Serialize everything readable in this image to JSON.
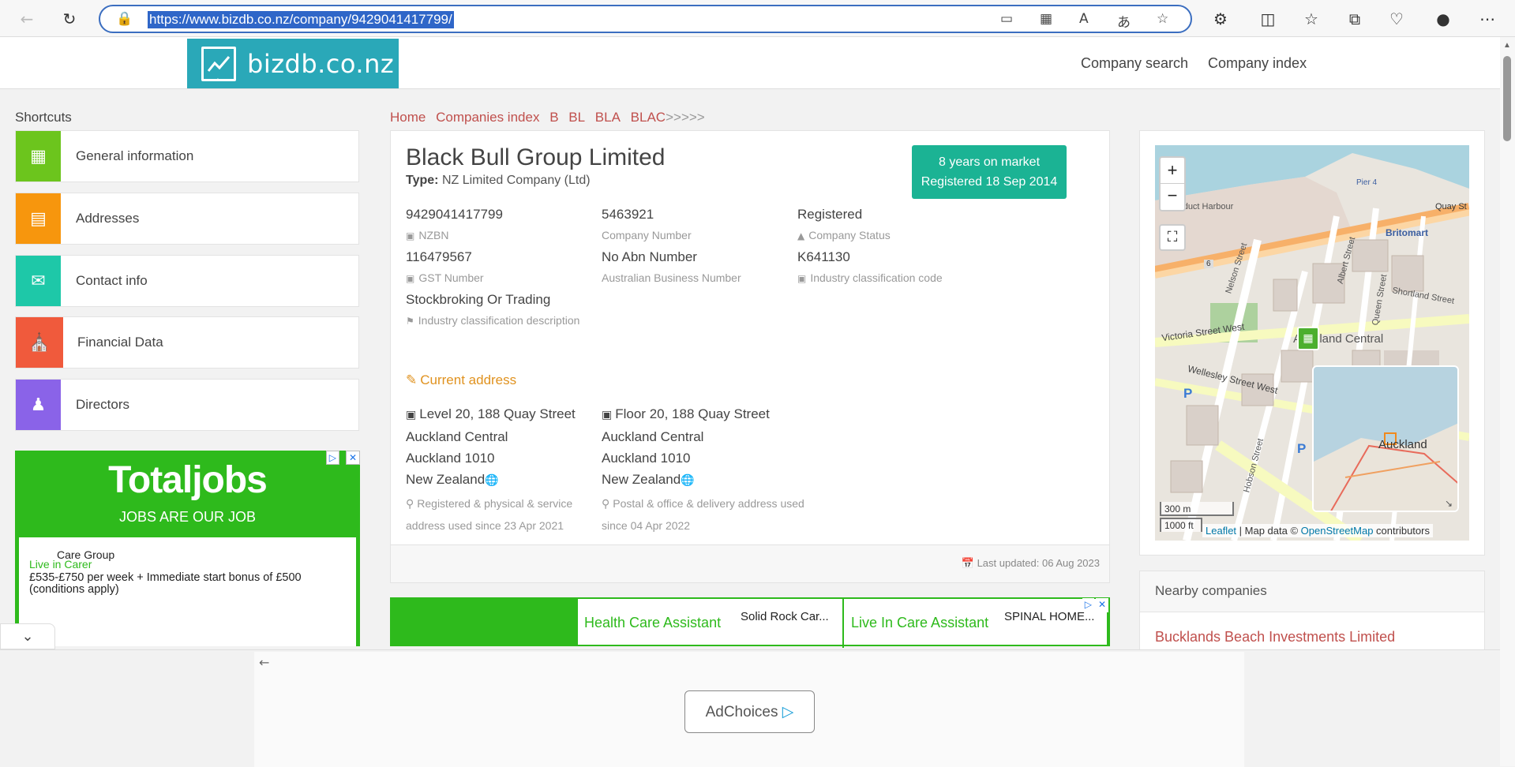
{
  "browser": {
    "url": "https://www.bizdb.co.nz/company/9429041417799/"
  },
  "site": {
    "logo_text": "bizdb.co.nz",
    "nav": [
      "Company search",
      "Company index"
    ]
  },
  "sidebar": {
    "title": "Shortcuts",
    "items": [
      {
        "label": "General information",
        "color": "#6cc51d",
        "icon": "grid-icon"
      },
      {
        "label": "Addresses",
        "color": "#f7960d",
        "icon": "document-icon"
      },
      {
        "label": "Contact info",
        "color": "#1ec8a8",
        "icon": "chat-icon"
      },
      {
        "label": "Financial Data",
        "color": "#f05a3c",
        "icon": "bank-icon"
      },
      {
        "label": "Directors",
        "color": "#8a63e8",
        "icon": "users-icon"
      }
    ]
  },
  "ad_left": {
    "brand": "Totaljobs",
    "tagline": "JOBS ARE OUR JOB",
    "job_title": "Live in Carer",
    "job_desc": "£535-£750 per week + Immediate start bonus of £500 (conditions apply)",
    "company": "Care Group"
  },
  "breadcrumb": [
    "Home",
    "Companies index",
    "B",
    "BL",
    "BLA",
    "BLAC",
    ">>>>>"
  ],
  "company": {
    "name": "Black Bull Group Limited",
    "type_label": "Type:",
    "type_value": "NZ Limited Company (Ltd)",
    "badge_line1": "8 years on market",
    "badge_line2": "Registered 18 Sep 2014",
    "fields": [
      {
        "value": "9429041417799",
        "label": "NZBN"
      },
      {
        "value": "5463921",
        "label": "Company Number"
      },
      {
        "value": "Registered",
        "label": "Company Status"
      },
      {
        "value": "116479567",
        "label": "GST Number"
      },
      {
        "value": "No Abn Number",
        "label": "Australian Business Number"
      },
      {
        "value": "K641130",
        "label": "Industry classification code"
      },
      {
        "value": "Stockbroking Or Trading",
        "label": "Industry classification description"
      }
    ],
    "current_address_title": "Current address",
    "addresses": [
      {
        "line1": "Level 20, 188 Quay Street",
        "line2": "Auckland Central",
        "line3": "Auckland 1010",
        "line4": "New Zealand",
        "note": "Registered & physical & service address used since 23 Apr 2021"
      },
      {
        "line1": "Floor 20, 188 Quay Street",
        "line2": "Auckland Central",
        "line3": "Auckland 1010",
        "line4": "New Zealand",
        "note": "Postal & office & delivery address used since 04 Apr 2022"
      }
    ],
    "last_updated": "Last updated: 06 Aug 2023"
  },
  "ad_main": {
    "job1": "Health Care Assistant",
    "company1": "Solid Rock Car...",
    "job2": "Live In Care Assistant",
    "company2": "SPINAL HOME..."
  },
  "map": {
    "zoom_in": "+",
    "zoom_out": "−",
    "labels": {
      "viaduct": "Viaduct Harbour",
      "britomart": "Britomart",
      "quay": "Quay St",
      "pier": "Pier 4",
      "victoria": "Victoria Street West",
      "wellesley": "Wellesley Street West",
      "auckland_central": "Auckland Central",
      "shortland": "Shortland Street",
      "albert": "Albert Street",
      "queen": "Queen Street",
      "nelson": "Nelson Street",
      "hobson": "Hobson Street",
      "minimap": "Auckland",
      "route": "6"
    },
    "scale1": "300 m",
    "scale2": "1000 ft",
    "attribution_leaflet": "Leaflet",
    "attribution_mid": " | Map data © ",
    "attribution_osm": "OpenStreetMap",
    "attribution_end": " contributors"
  },
  "nearby": {
    "title": "Nearby companies",
    "items": [
      "Bucklands Beach Investments Limited"
    ]
  },
  "bottom_ad": {
    "adchoices": "AdChoices"
  }
}
